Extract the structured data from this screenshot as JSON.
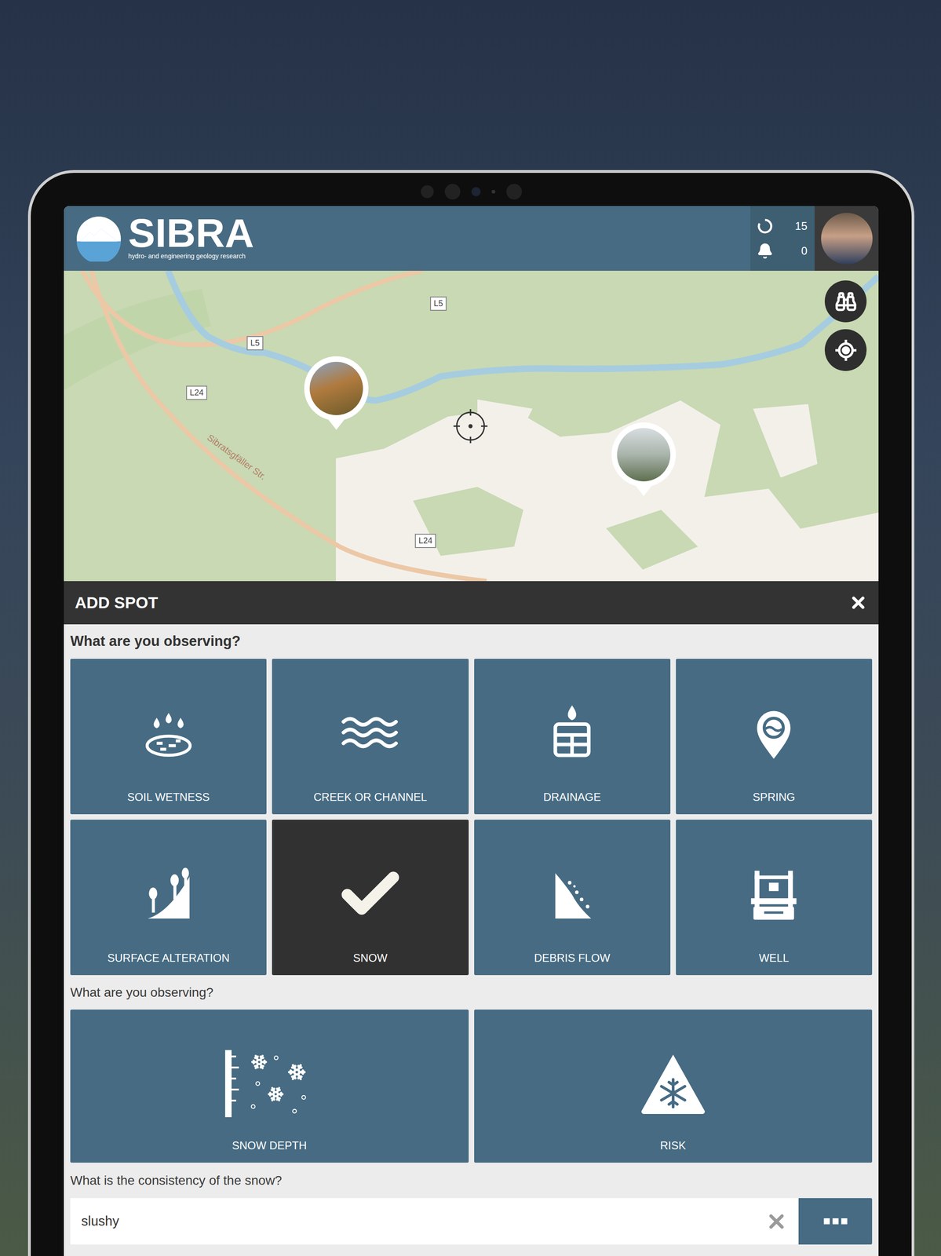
{
  "header": {
    "logo": "SIBRA",
    "tagline": "hydro- and engineering geology research",
    "sync_count": "15",
    "notification_count": "0"
  },
  "map": {
    "labels": [
      {
        "text": "L5",
        "kind": "shield"
      },
      {
        "text": "L5",
        "kind": "shield"
      },
      {
        "text": "L24",
        "kind": "shield"
      },
      {
        "text": "L24",
        "kind": "shield"
      },
      {
        "text": "Sibratsgfäller Str.",
        "kind": "street"
      }
    ]
  },
  "panel": {
    "title": "ADD SPOT",
    "question": "What are you observing?",
    "categories": [
      {
        "label": "SOIL WETNESS",
        "selected": false
      },
      {
        "label": "CREEK OR CHANNEL",
        "selected": false
      },
      {
        "label": "DRAINAGE",
        "selected": false
      },
      {
        "label": "SPRING",
        "selected": false
      },
      {
        "label": "SURFACE ALTERATION",
        "selected": false
      },
      {
        "label": "SNOW",
        "selected": true
      },
      {
        "label": "DEBRIS FLOW",
        "selected": false
      },
      {
        "label": "WELL",
        "selected": false
      }
    ],
    "subquestion": "What are you observing?",
    "subcategories": [
      {
        "label": "SNOW DEPTH",
        "selected": false
      },
      {
        "label": "RISK",
        "selected": false
      }
    ],
    "consistency": {
      "label": "What is the consistency of the snow?",
      "value": "slushy"
    }
  }
}
